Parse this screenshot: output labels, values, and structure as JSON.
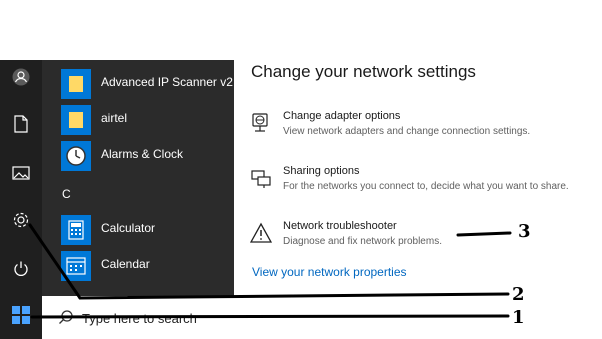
{
  "start_menu": {
    "rail_icons": [
      "user-icon",
      "document-icon",
      "pictures-icon",
      "settings-icon",
      "power-icon"
    ],
    "apps": [
      {
        "label": "Advanced IP Scanner v2",
        "icon": "folder-icon"
      },
      {
        "label": "airtel",
        "icon": "folder-icon"
      },
      {
        "label": "Alarms & Clock",
        "icon": "clock-icon"
      },
      {
        "label": "Calculator",
        "icon": "calculator-icon"
      },
      {
        "label": "Calendar",
        "icon": "calendar-icon"
      }
    ],
    "section_letter": "C"
  },
  "taskbar": {
    "search_placeholder": "Type here to search",
    "start_icon": "windows-logo-icon"
  },
  "network_settings": {
    "title": "Change your network settings",
    "options": [
      {
        "title": "Change adapter options",
        "description": "View network adapters and change connection settings.",
        "icon": "adapter-icon"
      },
      {
        "title": "Sharing options",
        "description": "For the networks you connect to, decide what you want to share.",
        "icon": "sharing-icon"
      },
      {
        "title": "Network troubleshooter",
        "description": "Diagnose and fix network problems.",
        "icon": "warning-icon"
      }
    ],
    "link": "View your network properties"
  },
  "annotations": {
    "one": "1",
    "two": "2",
    "three": "3"
  },
  "colors": {
    "rail": "#1f1f1f",
    "app_list": "#2b2b2b",
    "tile": "#0078d7",
    "link": "#0067c0"
  }
}
